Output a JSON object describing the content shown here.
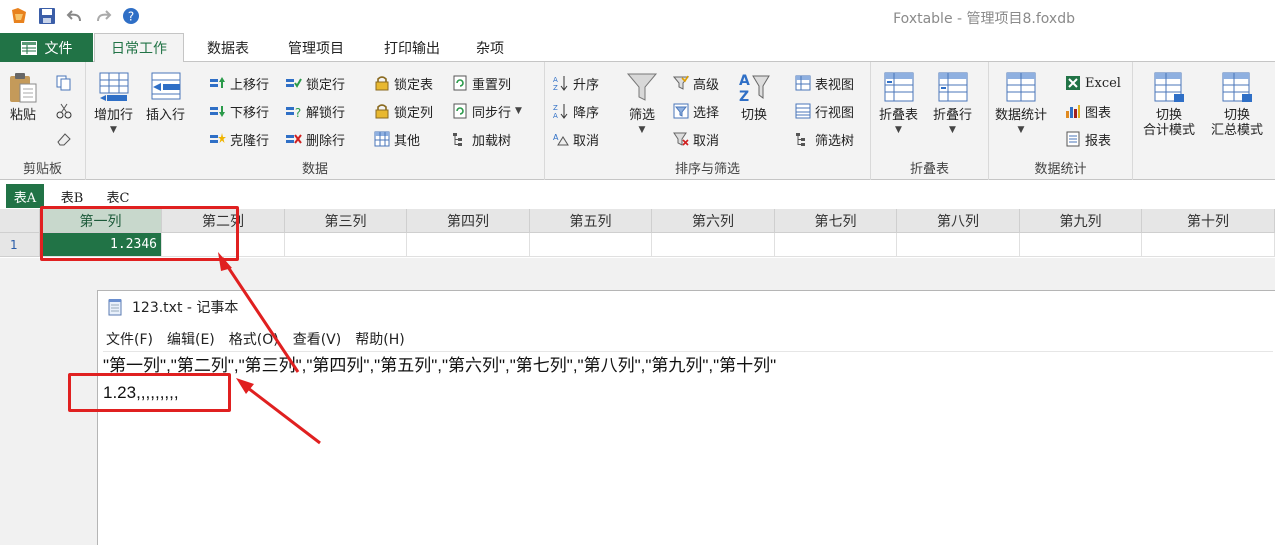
{
  "app": {
    "title": "Foxtable - 管理项目8.foxdb"
  },
  "tabs": {
    "file": "文件",
    "items": [
      "日常工作",
      "数据表",
      "管理项目",
      "打印输出",
      "杂项"
    ],
    "active": "日常工作"
  },
  "ribbon": {
    "clipboard": {
      "label": "剪贴板",
      "paste": "粘贴"
    },
    "data": {
      "label": "数据",
      "add_row": "增加行",
      "insert_row": "插入行",
      "move_up": "上移行",
      "move_down": "下移行",
      "clone_row": "克隆行",
      "lock_row": "锁定行",
      "unlock_row": "解锁行",
      "delete_row": "删除行",
      "lock_table": "锁定表",
      "lock_column": "锁定列",
      "other": "其他",
      "reset_column": "重置列",
      "sync_row": "同步行",
      "load_tree": "加载树"
    },
    "sort_filter": {
      "label": "排序与筛选",
      "asc": "升序",
      "desc": "降序",
      "cancel": "取消",
      "filter": "筛选",
      "advanced": "高级",
      "select": "选择",
      "cancel2": "取消",
      "switch": "切换",
      "table_view": "表视图",
      "row_view": "行视图",
      "filter_tree": "筛选树"
    },
    "fold": {
      "label": "折叠表",
      "fold_table": "折叠表",
      "fold_row": "折叠行"
    },
    "stats": {
      "label": "数据统计",
      "data_stats": "数据统计",
      "excel": "Excel",
      "chart": "图表",
      "report": "报表",
      "switch_total_l1": "切换",
      "switch_total_l2": "合计模式",
      "switch_summary_l1": "切换",
      "switch_summary_l2": "汇总模式"
    }
  },
  "sheets": [
    "表A",
    "表B",
    "表C"
  ],
  "grid": {
    "columns": [
      "第一列",
      "第二列",
      "第三列",
      "第四列",
      "第五列",
      "第六列",
      "第七列",
      "第八列",
      "第九列",
      "第十列"
    ],
    "row_number": "1",
    "cell_value": "1.2346"
  },
  "notepad": {
    "title": "123.txt - 记事本",
    "menu": [
      "文件(F)",
      "编辑(E)",
      "格式(O)",
      "查看(V)",
      "帮助(H)"
    ],
    "line1": "\"第一列\",\"第二列\",\"第三列\",\"第四列\",\"第五列\",\"第六列\",\"第七列\",\"第八列\",\"第九列\",\"第十列\"",
    "line2": "1.23,,,,,,,,,"
  },
  "colors": {
    "accent": "#217346",
    "annotation": "#e02020"
  }
}
